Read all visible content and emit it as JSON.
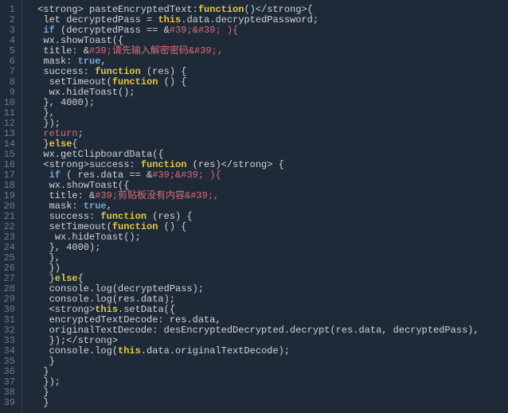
{
  "line_count": 39,
  "tokens": {
    "keyword_if": "if",
    "keyword_return": "return",
    "keyword_else": "else",
    "keyword_function": "function",
    "keyword_this": "this",
    "bool_true": "true"
  },
  "code_lines": [
    {
      "n": 1,
      "segs": [
        {
          "t": " <strong> pasteEncryptedText:",
          "c": "tag"
        },
        {
          "t": "function",
          "c": "fn"
        },
        {
          "t": "()</strong>{",
          "c": "tag"
        }
      ]
    },
    {
      "n": 2,
      "segs": [
        {
          "t": "  let decryptedPass = ",
          "c": ""
        },
        {
          "t": "this",
          "c": "self"
        },
        {
          "t": ".data.decryptedPassword;",
          "c": ""
        }
      ]
    },
    {
      "n": 3,
      "segs": [
        {
          "t": "  ",
          "c": ""
        },
        {
          "t": "if",
          "c": "kw"
        },
        {
          "t": " (decryptedPass == &",
          "c": ""
        },
        {
          "t": "#39;&#39; ){",
          "c": "str"
        }
      ]
    },
    {
      "n": 4,
      "segs": [
        {
          "t": "  wx.showToast({",
          "c": ""
        }
      ]
    },
    {
      "n": 5,
      "segs": [
        {
          "t": "  title: &",
          "c": ""
        },
        {
          "t": "#39;请先输入解密密码&#39;,",
          "c": "str"
        }
      ]
    },
    {
      "n": 6,
      "segs": [
        {
          "t": "  mask: ",
          "c": ""
        },
        {
          "t": "true",
          "c": "bool"
        },
        {
          "t": ",",
          "c": ""
        }
      ]
    },
    {
      "n": 7,
      "segs": [
        {
          "t": "  success: ",
          "c": ""
        },
        {
          "t": "function",
          "c": "fn"
        },
        {
          "t": " (res) {",
          "c": ""
        }
      ]
    },
    {
      "n": 8,
      "segs": [
        {
          "t": "   setTimeout(",
          "c": ""
        },
        {
          "t": "function",
          "c": "fn"
        },
        {
          "t": " () {",
          "c": ""
        }
      ]
    },
    {
      "n": 9,
      "segs": [
        {
          "t": "   wx.hideToast();",
          "c": ""
        }
      ]
    },
    {
      "n": 10,
      "segs": [
        {
          "t": "  }, 4000);",
          "c": ""
        }
      ]
    },
    {
      "n": 11,
      "segs": [
        {
          "t": "  },",
          "c": ""
        }
      ]
    },
    {
      "n": 12,
      "segs": [
        {
          "t": "  });",
          "c": ""
        }
      ]
    },
    {
      "n": 13,
      "segs": [
        {
          "t": "  ",
          "c": ""
        },
        {
          "t": "return",
          "c": "str"
        },
        {
          "t": ";",
          "c": ""
        }
      ]
    },
    {
      "n": 14,
      "segs": [
        {
          "t": "  }",
          "c": ""
        },
        {
          "t": "else",
          "c": "fn"
        },
        {
          "t": "{",
          "c": ""
        }
      ]
    },
    {
      "n": 15,
      "segs": [
        {
          "t": "  wx.getClipboardData({",
          "c": ""
        }
      ]
    },
    {
      "n": 16,
      "segs": [
        {
          "t": "  <strong>success: ",
          "c": ""
        },
        {
          "t": "function",
          "c": "fn"
        },
        {
          "t": " (res)</strong> {",
          "c": ""
        }
      ]
    },
    {
      "n": 17,
      "segs": [
        {
          "t": "   ",
          "c": ""
        },
        {
          "t": "if",
          "c": "kw"
        },
        {
          "t": " ( res.data == &",
          "c": ""
        },
        {
          "t": "#39;&#39; ){",
          "c": "str"
        }
      ]
    },
    {
      "n": 18,
      "segs": [
        {
          "t": "   wx.showToast({",
          "c": ""
        }
      ]
    },
    {
      "n": 19,
      "segs": [
        {
          "t": "   title: &",
          "c": ""
        },
        {
          "t": "#39;剪贴板没有内容&#39;,",
          "c": "str"
        }
      ]
    },
    {
      "n": 20,
      "segs": [
        {
          "t": "   mask: ",
          "c": ""
        },
        {
          "t": "true",
          "c": "bool"
        },
        {
          "t": ",",
          "c": ""
        }
      ]
    },
    {
      "n": 21,
      "segs": [
        {
          "t": "   success: ",
          "c": ""
        },
        {
          "t": "function",
          "c": "fn"
        },
        {
          "t": " (res) {",
          "c": ""
        }
      ]
    },
    {
      "n": 22,
      "segs": [
        {
          "t": "   setTimeout(",
          "c": ""
        },
        {
          "t": "function",
          "c": "fn"
        },
        {
          "t": " () {",
          "c": ""
        }
      ]
    },
    {
      "n": 23,
      "segs": [
        {
          "t": "    wx.hideToast();",
          "c": ""
        }
      ]
    },
    {
      "n": 24,
      "segs": [
        {
          "t": "   }, 4000);",
          "c": ""
        }
      ]
    },
    {
      "n": 25,
      "segs": [
        {
          "t": "   },",
          "c": ""
        }
      ]
    },
    {
      "n": 26,
      "segs": [
        {
          "t": "   })",
          "c": ""
        }
      ]
    },
    {
      "n": 27,
      "segs": [
        {
          "t": "   }",
          "c": ""
        },
        {
          "t": "else",
          "c": "fn"
        },
        {
          "t": "{",
          "c": ""
        }
      ]
    },
    {
      "n": 28,
      "segs": [
        {
          "t": "   console.log(decryptedPass);",
          "c": ""
        }
      ]
    },
    {
      "n": 29,
      "segs": [
        {
          "t": "   console.log(res.data);",
          "c": ""
        }
      ]
    },
    {
      "n": 30,
      "segs": [
        {
          "t": "   <strong>",
          "c": ""
        },
        {
          "t": "this",
          "c": "self"
        },
        {
          "t": ".setData({",
          "c": ""
        }
      ]
    },
    {
      "n": 31,
      "segs": [
        {
          "t": "   encryptedTextDecode: res.data,",
          "c": ""
        }
      ]
    },
    {
      "n": 32,
      "segs": [
        {
          "t": "   originalTextDecode: desEncryptedDecrypted.decrypt(res.data, decryptedPass),",
          "c": ""
        }
      ]
    },
    {
      "n": 33,
      "segs": [
        {
          "t": "   });</strong>",
          "c": ""
        }
      ]
    },
    {
      "n": 34,
      "segs": [
        {
          "t": "   console.log(",
          "c": ""
        },
        {
          "t": "this",
          "c": "self"
        },
        {
          "t": ".data.originalTextDecode);",
          "c": ""
        }
      ]
    },
    {
      "n": 35,
      "segs": [
        {
          "t": "   }",
          "c": ""
        }
      ]
    },
    {
      "n": 36,
      "segs": [
        {
          "t": "  }",
          "c": ""
        }
      ]
    },
    {
      "n": 37,
      "segs": [
        {
          "t": "  });",
          "c": ""
        }
      ]
    },
    {
      "n": 38,
      "segs": [
        {
          "t": "  }",
          "c": ""
        }
      ]
    },
    {
      "n": 39,
      "segs": [
        {
          "t": "  }",
          "c": ""
        }
      ]
    }
  ]
}
